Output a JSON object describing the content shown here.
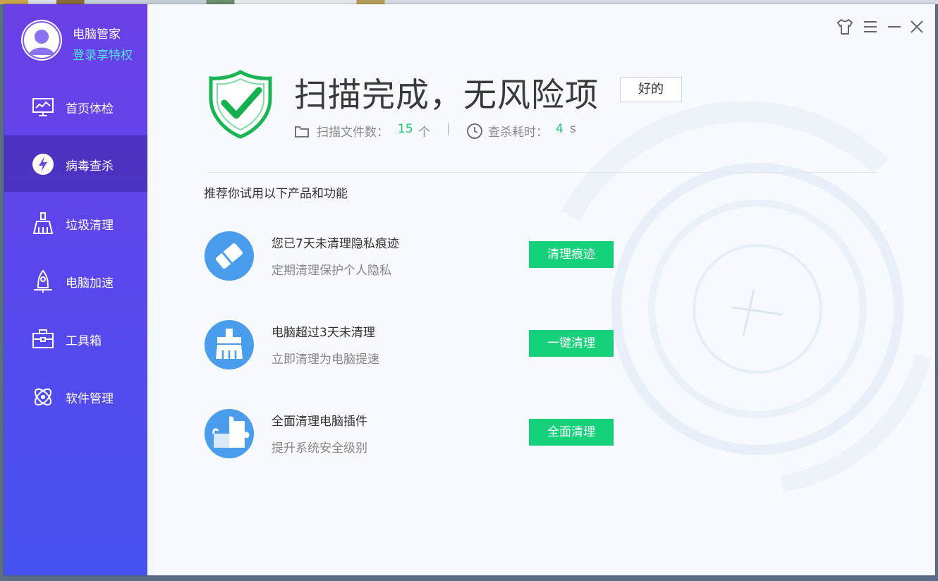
{
  "profile": {
    "app_name": "电脑管家",
    "login_label": "登录享特权",
    "avatar_icon": "user-avatar-icon"
  },
  "sidebar": {
    "items": [
      {
        "label": "首页体检",
        "icon": "monitor-chart-icon",
        "active": false
      },
      {
        "label": "病毒查杀",
        "icon": "lightning-shield-icon",
        "active": true
      },
      {
        "label": "垃圾清理",
        "icon": "broom-icon",
        "active": false
      },
      {
        "label": "电脑加速",
        "icon": "rocket-icon",
        "active": false
      },
      {
        "label": "工具箱",
        "icon": "toolbox-icon",
        "active": false
      },
      {
        "label": "软件管理",
        "icon": "software-grid-icon",
        "active": false
      }
    ]
  },
  "window_controls": {
    "icons": [
      "skin-shirt-icon",
      "menu-icon",
      "minimize-icon",
      "close-icon"
    ]
  },
  "scan_result": {
    "title": "扫描完成，无风险项",
    "ok_label": "好的",
    "files_label": "扫描文件数：",
    "files_count": "15",
    "files_unit": "个",
    "separator": "|",
    "time_label": "查杀耗时：",
    "time_value": "4",
    "time_unit": "s"
  },
  "recommendations": {
    "heading": "推荐你试用以下产品和功能",
    "items": [
      {
        "title": "您已7天未清理隐私痕迹",
        "subtitle": "定期清理保护个人隐私",
        "button": "清理痕迹",
        "icon": "eraser-icon"
      },
      {
        "title": "电脑超过3天未清理",
        "subtitle": "立即清理为电脑提速",
        "button": "一键清理",
        "icon": "broom-icon"
      },
      {
        "title": "全面清理电脑插件",
        "subtitle": "提升系统安全级别",
        "button": "全面清理",
        "icon": "puzzle-icon"
      }
    ]
  },
  "colors": {
    "sidebar_top": "#6b3fe6",
    "sidebar_bottom": "#4552ef",
    "accent_green": "#14d17a",
    "login_cyan": "#4ee3ff",
    "icon_blue": "#4a9ded"
  }
}
